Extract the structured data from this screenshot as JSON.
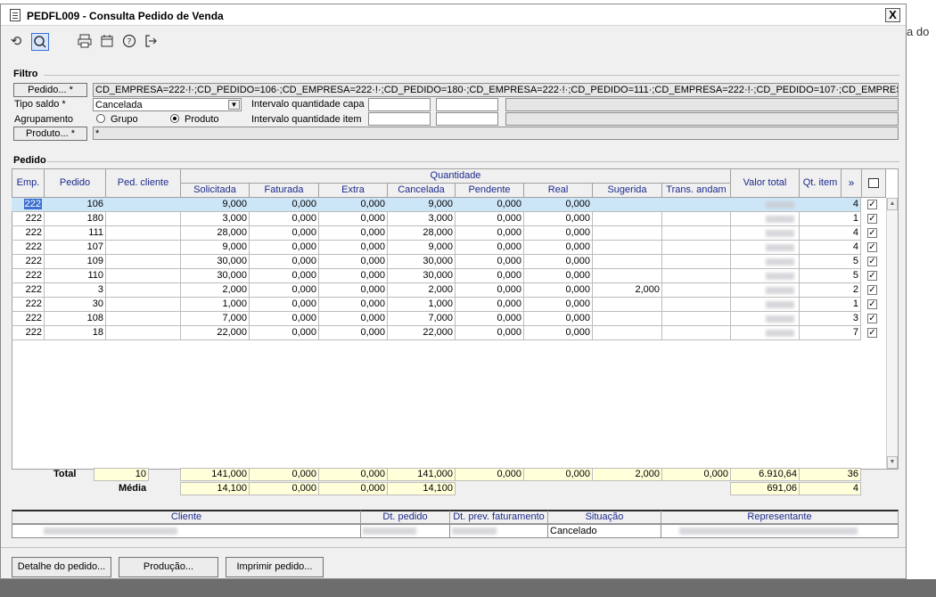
{
  "bg_text": "a do",
  "window": {
    "title": "PEDFL009 - Consulta Pedido de Venda",
    "close": "X"
  },
  "toolbar": {
    "icons": [
      "undo-icon",
      "search-icon",
      "print-icon",
      "calendar-icon",
      "help-icon",
      "exit-icon"
    ]
  },
  "filtro": {
    "title": "Filtro",
    "pedido_btn": "Pedido... *",
    "pedido_value": "CD_EMPRESA=222·!·;CD_PEDIDO=106·;CD_EMPRESA=222·!·;CD_PEDIDO=180·;CD_EMPRESA=222·!·;CD_PEDIDO=111·;CD_EMPRESA=222·!·;CD_PEDIDO=107·;CD_EMPRESA=222·!·;CD_PE",
    "tipo_saldo_label": "Tipo saldo *",
    "tipo_saldo_value": "Cancelada",
    "intervalo_capa": "Intervalo quantidade capa",
    "intervalo_item": "Intervalo quantidade item",
    "agrupamento_label": "Agrupamento",
    "grupo": "Grupo",
    "produto_radio": "Produto",
    "produto_btn": "Produto... *",
    "produto_value": "*"
  },
  "pedido": {
    "title": "Pedido",
    "headers": {
      "emp": "Emp.",
      "pedido": "Pedido",
      "ped_cliente": "Ped. cliente",
      "quantidade": "Quantidade",
      "solicitada": "Solicitada",
      "faturada": "Faturada",
      "extra": "Extra",
      "cancelada": "Cancelada",
      "pendente": "Pendente",
      "real": "Real",
      "sugerida": "Sugerida",
      "trans_andam": "Trans. andam",
      "valor_total": "Valor total",
      "qt_item": "Qt. item",
      "more": "»"
    },
    "rows": [
      {
        "emp": "222",
        "pedido": "106",
        "solicitada": "9,000",
        "faturada": "0,000",
        "extra": "0,000",
        "cancelada": "9,000",
        "pendente": "0,000",
        "real": "0,000",
        "sugerida": "",
        "qt_item": "4"
      },
      {
        "emp": "222",
        "pedido": "180",
        "solicitada": "3,000",
        "faturada": "0,000",
        "extra": "0,000",
        "cancelada": "3,000",
        "pendente": "0,000",
        "real": "0,000",
        "sugerida": "",
        "qt_item": "1"
      },
      {
        "emp": "222",
        "pedido": "111",
        "solicitada": "28,000",
        "faturada": "0,000",
        "extra": "0,000",
        "cancelada": "28,000",
        "pendente": "0,000",
        "real": "0,000",
        "sugerida": "",
        "qt_item": "4"
      },
      {
        "emp": "222",
        "pedido": "107",
        "solicitada": "9,000",
        "faturada": "0,000",
        "extra": "0,000",
        "cancelada": "9,000",
        "pendente": "0,000",
        "real": "0,000",
        "sugerida": "",
        "qt_item": "4"
      },
      {
        "emp": "222",
        "pedido": "109",
        "solicitada": "30,000",
        "faturada": "0,000",
        "extra": "0,000",
        "cancelada": "30,000",
        "pendente": "0,000",
        "real": "0,000",
        "sugerida": "",
        "qt_item": "5"
      },
      {
        "emp": "222",
        "pedido": "110",
        "solicitada": "30,000",
        "faturada": "0,000",
        "extra": "0,000",
        "cancelada": "30,000",
        "pendente": "0,000",
        "real": "0,000",
        "sugerida": "",
        "qt_item": "5"
      },
      {
        "emp": "222",
        "pedido": "3",
        "solicitada": "2,000",
        "faturada": "0,000",
        "extra": "0,000",
        "cancelada": "2,000",
        "pendente": "0,000",
        "real": "0,000",
        "sugerida": "2,000",
        "qt_item": "2"
      },
      {
        "emp": "222",
        "pedido": "30",
        "solicitada": "1,000",
        "faturada": "0,000",
        "extra": "0,000",
        "cancelada": "1,000",
        "pendente": "0,000",
        "real": "0,000",
        "sugerida": "",
        "qt_item": "1"
      },
      {
        "emp": "222",
        "pedido": "108",
        "solicitada": "7,000",
        "faturada": "0,000",
        "extra": "0,000",
        "cancelada": "7,000",
        "pendente": "0,000",
        "real": "0,000",
        "sugerida": "",
        "qt_item": "3"
      },
      {
        "emp": "222",
        "pedido": "18",
        "solicitada": "22,000",
        "faturada": "0,000",
        "extra": "0,000",
        "cancelada": "22,000",
        "pendente": "0,000",
        "real": "0,000",
        "sugerida": "",
        "qt_item": "7"
      }
    ],
    "total": {
      "label": "Total",
      "count": "10",
      "solicitada": "141,000",
      "faturada": "0,000",
      "extra": "0,000",
      "cancelada": "141,000",
      "pendente": "0,000",
      "real": "0,000",
      "sugerida": "2,000",
      "trans": "0,000",
      "valor": "6.910,64",
      "qt_item": "36"
    },
    "media": {
      "label": "Média",
      "solicitada": "14,100",
      "faturada": "0,000",
      "extra": "0,000",
      "cancelada": "14,100",
      "valor": "691,06",
      "qt_item": "4"
    }
  },
  "footer": {
    "headers": {
      "cliente": "Cliente",
      "dt_pedido": "Dt. pedido",
      "dt_prev": "Dt. prev. faturamento",
      "situacao": "Situação",
      "representante": "Representante"
    },
    "situacao": "Cancelado"
  },
  "buttons": {
    "detalhe": "Detalhe do pedido...",
    "producao": "Produção...",
    "imprimir": "Imprimir pedido..."
  }
}
